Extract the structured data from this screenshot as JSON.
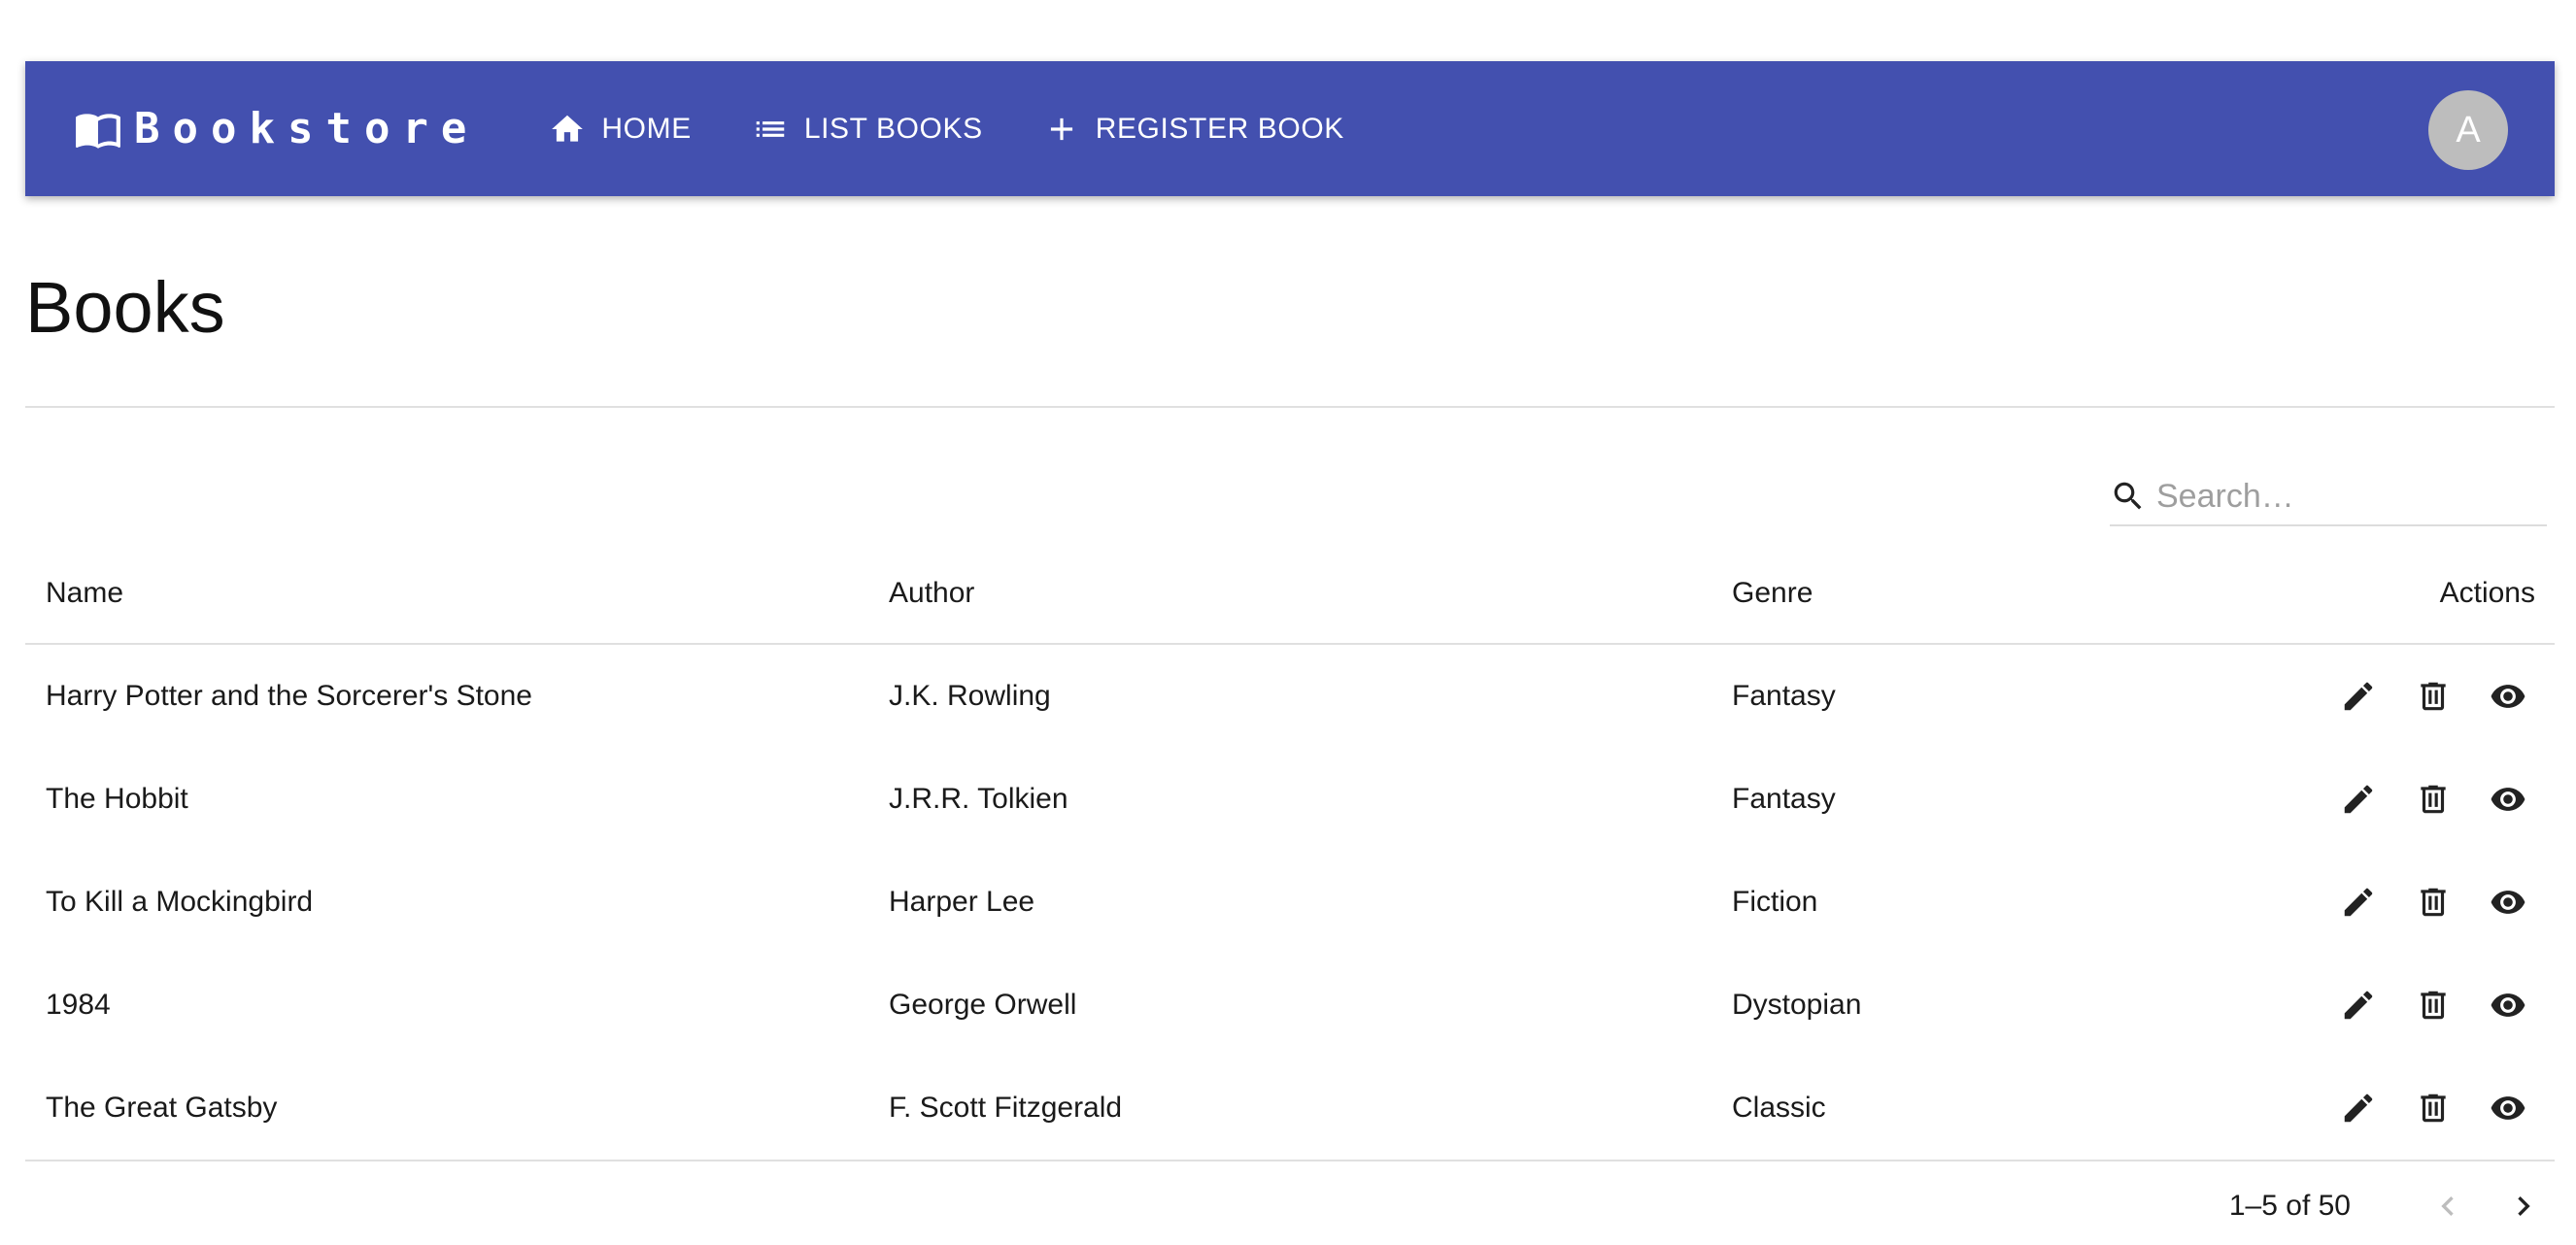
{
  "appbar": {
    "brand": "Bookstore",
    "brand_icon": "book-open-icon",
    "nav": [
      {
        "label": "HOME",
        "icon": "home-icon"
      },
      {
        "label": "LIST BOOKS",
        "icon": "list-icon"
      },
      {
        "label": "REGISTER BOOK",
        "icon": "plus-icon"
      }
    ],
    "avatar_initial": "A",
    "background": "#4350af"
  },
  "page": {
    "title": "Books"
  },
  "search": {
    "placeholder": "Search…",
    "value": ""
  },
  "table": {
    "columns": {
      "name": "Name",
      "author": "Author",
      "genre": "Genre",
      "actions": "Actions"
    },
    "rows": [
      {
        "name": "Harry Potter and the Sorcerer's Stone",
        "author": "J.K. Rowling",
        "genre": "Fantasy"
      },
      {
        "name": "The Hobbit",
        "author": "J.R.R. Tolkien",
        "genre": "Fantasy"
      },
      {
        "name": "To Kill a Mockingbird",
        "author": "Harper Lee",
        "genre": "Fiction"
      },
      {
        "name": "1984",
        "author": "George Orwell",
        "genre": "Dystopian"
      },
      {
        "name": "The Great Gatsby",
        "author": "F. Scott Fitzgerald",
        "genre": "Classic"
      }
    ],
    "row_actions": [
      "edit-icon",
      "delete-icon",
      "view-icon"
    ]
  },
  "pagination": {
    "label": "1–5 of 50",
    "prev_enabled": false,
    "next_enabled": true
  }
}
